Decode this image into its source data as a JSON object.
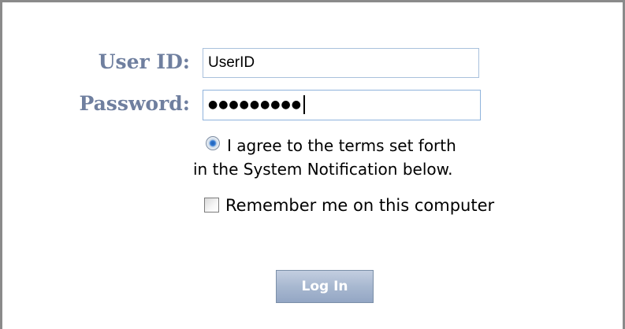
{
  "form": {
    "user_id_label": "User ID:",
    "user_id_value": "UserID",
    "password_label": "Password:",
    "password_mask": "●●●●●●●●●",
    "agree_radio_checked": true,
    "agree_text_line1": "I agree to the terms set forth",
    "agree_text_line2": "in the System Notification below.",
    "remember_checked": false,
    "remember_text": "Remember me on this computer",
    "login_button_label": "Log In"
  },
  "colors": {
    "label": "#6f7f9f",
    "field_border": "#a9c1dc",
    "button_bg": "#a8b8d0",
    "frame_border": "#8a8a8a"
  },
  "icons": {
    "agree_radio": "radio-selected-icon",
    "remember_checkbox": "checkbox-unchecked-icon"
  }
}
